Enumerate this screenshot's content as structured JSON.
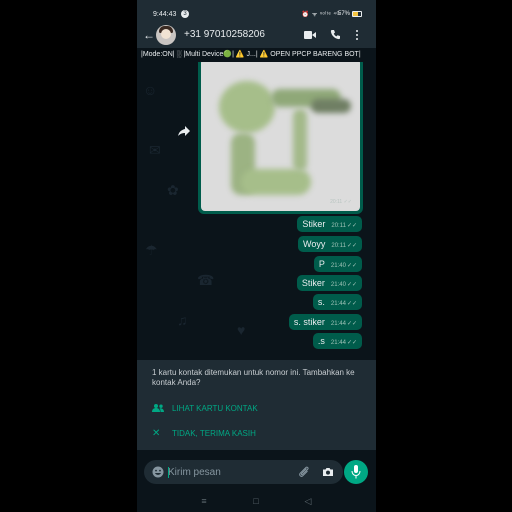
{
  "status_bar": {
    "time": "9:44:43",
    "notification_count": "3",
    "icons_text": "⏰ ᯤ ᵛᵒˡᵗᵉ ⁴ᴳ",
    "battery_text": "57%",
    "battery_level": 0.57
  },
  "header": {
    "contact_name": "+31 97010258206",
    "icons": [
      "back-arrow-icon",
      "avatar",
      "video-call-icon",
      "phone-call-icon",
      "more-vert-icon"
    ]
  },
  "bio": {
    "text": "|Mode:ON| ░ |Multi Device🟢| ⚠️ J...| ⚠️ OPEN PPCP BARENG BOT|"
  },
  "sticker": {
    "time": "20:11"
  },
  "messages": [
    {
      "text": "Stiker",
      "time": "20:11"
    },
    {
      "text": "Woyy",
      "time": "20:11"
    },
    {
      "text": "P",
      "time": "21:40"
    },
    {
      "text": "Stiker",
      "time": "21:40"
    },
    {
      "text": "s.",
      "time": "21:44"
    },
    {
      "text": "s. stiker",
      "time": "21:44"
    },
    {
      "text": ".s",
      "time": "21:44"
    }
  ],
  "unknown_contact_panel": {
    "text": "1 kartu kontak ditemukan untuk nomor ini. Tambahkan ke kontak Anda?",
    "view_contact_label": "LIHAT KARTU KONTAK",
    "dismiss_label": "TIDAK, TERIMA KASIH"
  },
  "input": {
    "placeholder": "Kirim pesan",
    "value": ""
  },
  "colors": {
    "background": "#0b141a",
    "panel": "#1f2c34",
    "outgoing_bubble": "#005c4b",
    "accent": "#00a884",
    "text": "#e9edef"
  },
  "nav_bar": {
    "icons": [
      "recent-apps-icon",
      "home-icon",
      "back-nav-icon"
    ]
  }
}
